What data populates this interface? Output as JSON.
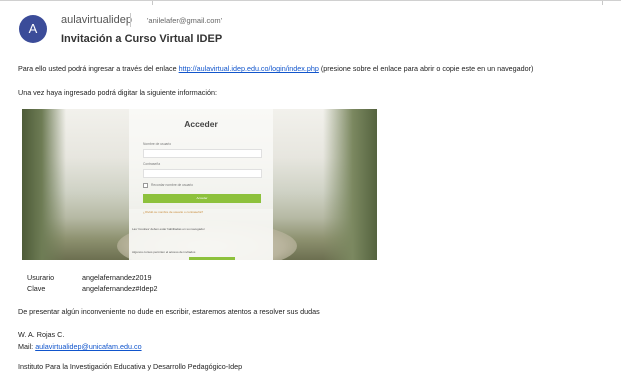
{
  "header": {
    "avatar_letter": "A",
    "sender_name": "aulavirtualidep",
    "recipient_email": "'anilelafer@gmail.com'",
    "subject": "Invitación a Curso Virtual IDEP"
  },
  "body": {
    "line1_pre": "Para ello usted podrá ingresar a través del enlace ",
    "line1_link": "http://aulavirtual.idep.edu.co/login/index.php",
    "line1_post": " (presione sobre el enlace para abrir o copie este en un navegador)",
    "line2": "Una vez haya ingresado podrá digitar la siguiente información:",
    "login_screenshot": {
      "title": "Acceder",
      "username_label": "Nombre de usuario",
      "password_label": "Contraseña",
      "remember_label": "Recordar nombre de usuario",
      "button_label": "Acceder",
      "forgot_text": "¿Olvidó su nombre de usuario o contraseña?",
      "cookies_text": "Las 'Cookies' deben estar habilitadas en su navegador",
      "guest_text": "Algunos cursos permiten el acceso de invitados"
    },
    "credentials": [
      {
        "label": "Usurario",
        "value": "angelafernandez2019"
      },
      {
        "label": "Clave",
        "value": "angelafernandez#Idep2"
      }
    ],
    "line3": "De presentar algún inconveniente no dude en escribir, estaremos atentos a resolver sus dudas",
    "signature_name": "W. A. Rojas C.",
    "mail_label": "Mail: ",
    "mail_link": "aulavirtualidep@unicafam.edu.co",
    "institute": "Instituto Para la Investigación Educativa y Desarrollo Pedagógico-Idep"
  },
  "colors": {
    "avatar_bg": "#3b4c99",
    "link": "#1155cc",
    "login_button": "#8dc13c"
  }
}
